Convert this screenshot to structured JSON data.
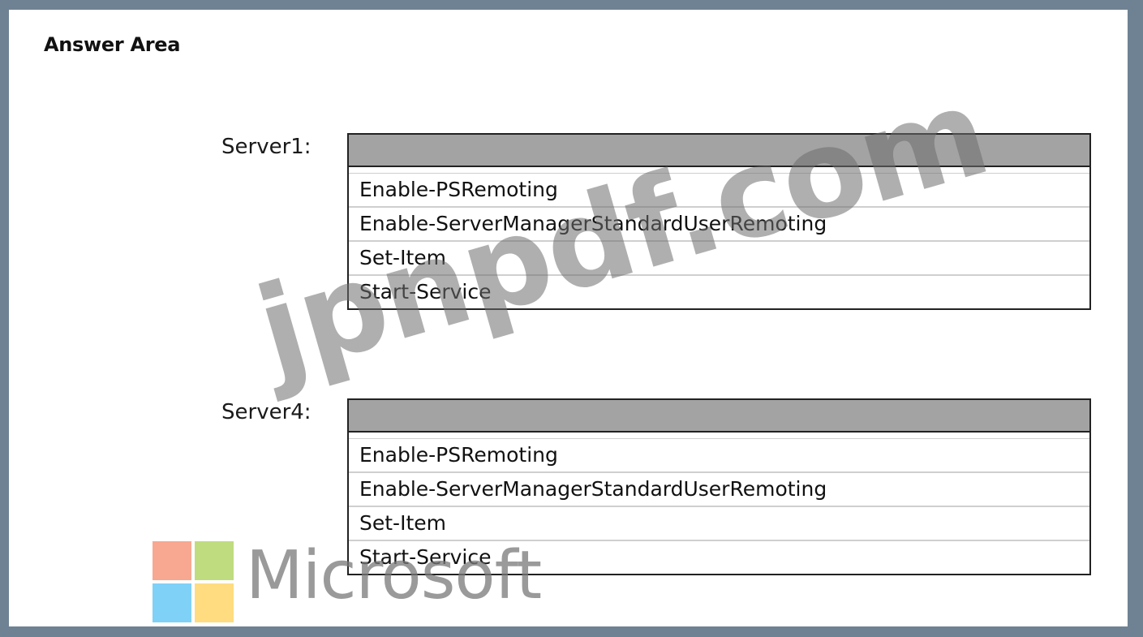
{
  "answer_area": {
    "title": "Answer Area"
  },
  "servers": [
    {
      "label": "Server1:",
      "options": [
        "Enable-PSRemoting",
        "Enable-ServerManagerStandardUserRemoting",
        "Set-Item",
        "Start-Service"
      ]
    },
    {
      "label": "Server4:",
      "options": [
        "Enable-PSRemoting",
        "Enable-ServerManagerStandardUserRemoting",
        "Set-Item",
        "Start-Service"
      ]
    }
  ],
  "watermark": {
    "text": "jpnpdf.com"
  },
  "brand": {
    "name": "Microsoft",
    "logo_colors": [
      "#f25022",
      "#7fba00",
      "#00a4ef",
      "#ffb900"
    ]
  },
  "colors": {
    "frame": "#6f8294",
    "dropdown_header": "#a3a3a3"
  }
}
